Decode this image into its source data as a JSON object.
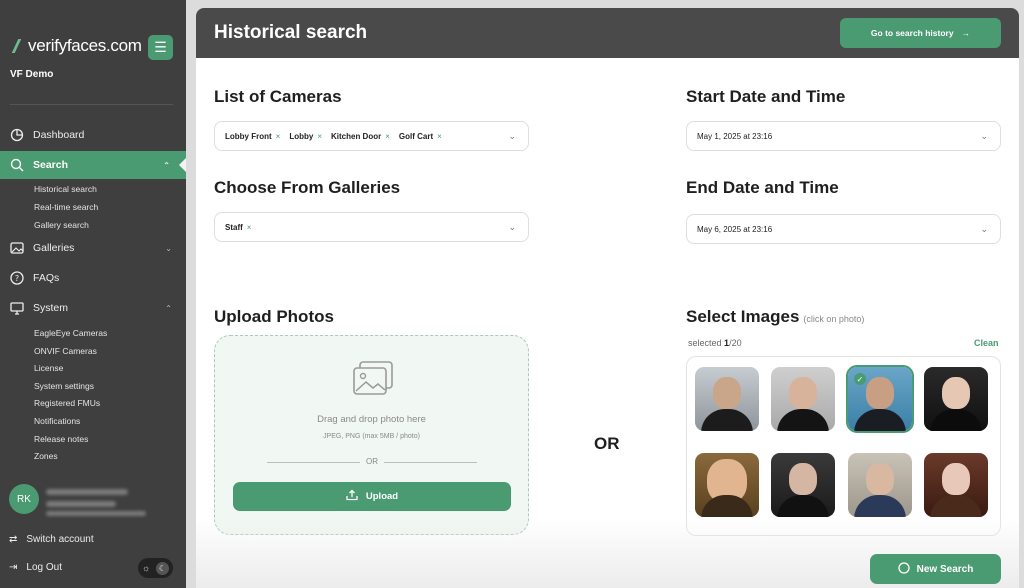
{
  "brand": {
    "name": "verifyfaces.com",
    "org": "VF Demo",
    "accent": "#4a9a72"
  },
  "sidebar": {
    "nav": [
      {
        "label": "Dashboard",
        "icon": "dashboard-icon"
      },
      {
        "label": "Search",
        "icon": "search-icon",
        "active": true
      },
      {
        "label": "Galleries",
        "icon": "image-icon"
      },
      {
        "label": "FAQs",
        "icon": "question-icon"
      },
      {
        "label": "System",
        "icon": "monitor-icon"
      }
    ],
    "search_sub": [
      "Historical search",
      "Real-time search",
      "Gallery search"
    ],
    "system_sub": [
      "EagleEye Cameras",
      "ONVIF Cameras",
      "License",
      "System settings",
      "Registered FMUs",
      "Notifications",
      "Release notes",
      "Zones"
    ],
    "user_initials": "RK",
    "switch_account": "Switch account",
    "logout": "Log Out"
  },
  "header": {
    "title": "Historical search",
    "history_button": "Go to search history"
  },
  "cameras": {
    "title": "List of Cameras",
    "selected": [
      "Lobby Front",
      "Lobby",
      "Kitchen Door",
      "Golf Cart"
    ]
  },
  "galleries": {
    "title": "Choose From Galleries",
    "selected": [
      "Staff"
    ]
  },
  "start": {
    "title": "Start Date and Time",
    "value": "May 1, 2025 at 23:16"
  },
  "end": {
    "title": "End Date and Time",
    "value": "May 6, 2025 at 23:16"
  },
  "upload": {
    "title": "Upload Photos",
    "drag_text": "Drag and drop photo here",
    "format_text": "JPEG, PNG (max 5MB / photo)",
    "or_small": "OR",
    "button": "Upload"
  },
  "or_big": "OR",
  "select_images": {
    "title": "Select Images",
    "hint": "(click on photo)",
    "selected_label": "selected",
    "selected_count": "1",
    "selected_total": "/20",
    "clean": "Clean"
  },
  "new_search": "New Search"
}
